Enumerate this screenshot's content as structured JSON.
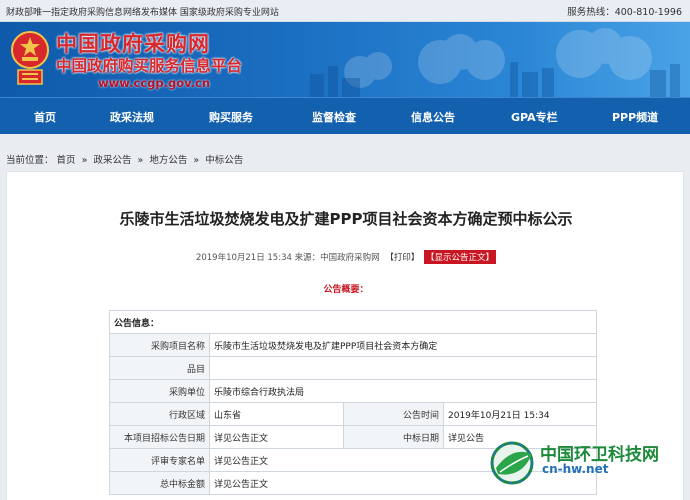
{
  "topbar": {
    "tagline": "财政部唯一指定政府采购信息网络发布媒体  国家级政府采购专业网站",
    "hotline": "服务热线：400-810-1996"
  },
  "header": {
    "site_name": "中国政府采购网",
    "site_subtitle": "中国政府购买服务信息平台",
    "site_url": "www.ccgp.gov.cn"
  },
  "nav": [
    {
      "label": "首页"
    },
    {
      "label": "政采法规"
    },
    {
      "label": "购买服务"
    },
    {
      "label": "监督检查"
    },
    {
      "label": "信息公告"
    },
    {
      "label": "GPA专栏"
    },
    {
      "label": "PPP频道"
    }
  ],
  "breadcrumb": {
    "prefix": "当前位置：",
    "items": [
      "首页",
      "政采公告",
      "地方公告",
      "中标公告"
    ],
    "separator": "»"
  },
  "article": {
    "title": "乐陵市生活垃圾焚烧发电及扩建PPP项目社会资本方确定预中标公示",
    "meta": "2019年10月21日 15:34 来源：中国政府采购网",
    "print_label": "【打印】",
    "show_label": "【显示公告正文】",
    "summary_label": "公告概要："
  },
  "info_table": {
    "header": "公告信息：",
    "rows": {
      "project_name": {
        "label": "采购项目名称",
        "value": "乐陵市生活垃圾焚烧发电及扩建PPP项目社会资本方确定"
      },
      "item": {
        "label": "品目",
        "value": ""
      },
      "purchaser": {
        "label": "采购单位",
        "value": "乐陵市综合行政执法局"
      },
      "region": {
        "label": "行政区域",
        "value": "山东省"
      },
      "publish_time": {
        "label": "公告时间",
        "value": "2019年10月21日 15:34"
      },
      "bid_notice_date": {
        "label": "本项目招标公告日期",
        "value": "详见公告正文"
      },
      "award_date": {
        "label": "中标日期",
        "value": "详见公告"
      },
      "experts": {
        "label": "评审专家名单",
        "value": "详见公告正文"
      },
      "amount": {
        "label": "总中标金额",
        "value": "详见公告正文"
      }
    }
  },
  "watermark": {
    "name": "中国环卫科技网",
    "url": "cn-hw.net"
  },
  "colors": {
    "nav_bg": "#1360ae",
    "brand_red": "#d7282d",
    "summary_red": "#c81623",
    "watermark_green": "#1c8a3a"
  }
}
